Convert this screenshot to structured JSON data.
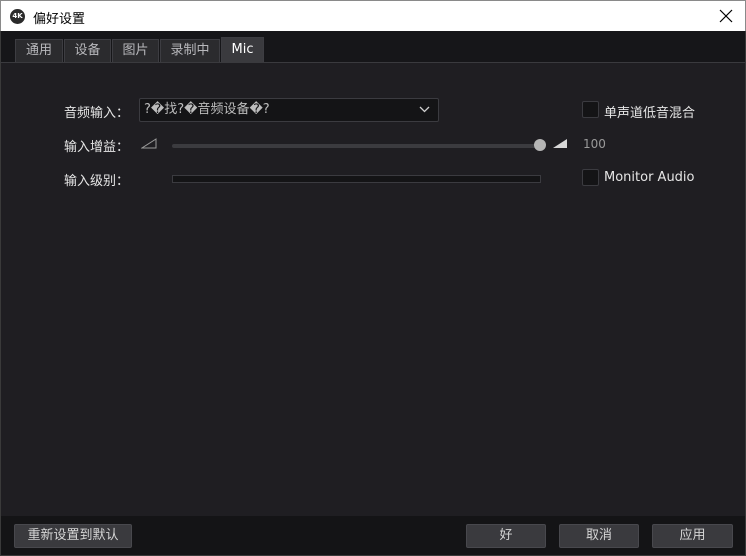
{
  "window": {
    "title": "偏好设置",
    "icon_text": "4K",
    "close_icon": "close-icon"
  },
  "tabs": [
    {
      "label": "通用",
      "active": false
    },
    {
      "label": "设备",
      "active": false
    },
    {
      "label": "图片",
      "active": false
    },
    {
      "label": "录制中",
      "active": false
    },
    {
      "label": "Mic",
      "active": true
    }
  ],
  "mic": {
    "audio_input_label": "音频输入：",
    "audio_input_value": "?�找?�音频设备�?",
    "mono_mix_label": "单声道低音混合",
    "mono_mix_checked": false,
    "input_gain_label": "输入增益：",
    "input_gain_value": "100",
    "input_level_label": "输入级别：",
    "input_level_fill": 0,
    "monitor_audio_label": "Monitor Audio",
    "monitor_audio_checked": false
  },
  "footer": {
    "reset_label": "重新设置到默认",
    "ok_label": "好",
    "cancel_label": "取消",
    "apply_label": "应用"
  },
  "colors": {
    "background": "#1f1e22",
    "tab_active": "#3a3a3e",
    "button": "#3a3a3e",
    "slider_handle": "#b5b5b5"
  }
}
